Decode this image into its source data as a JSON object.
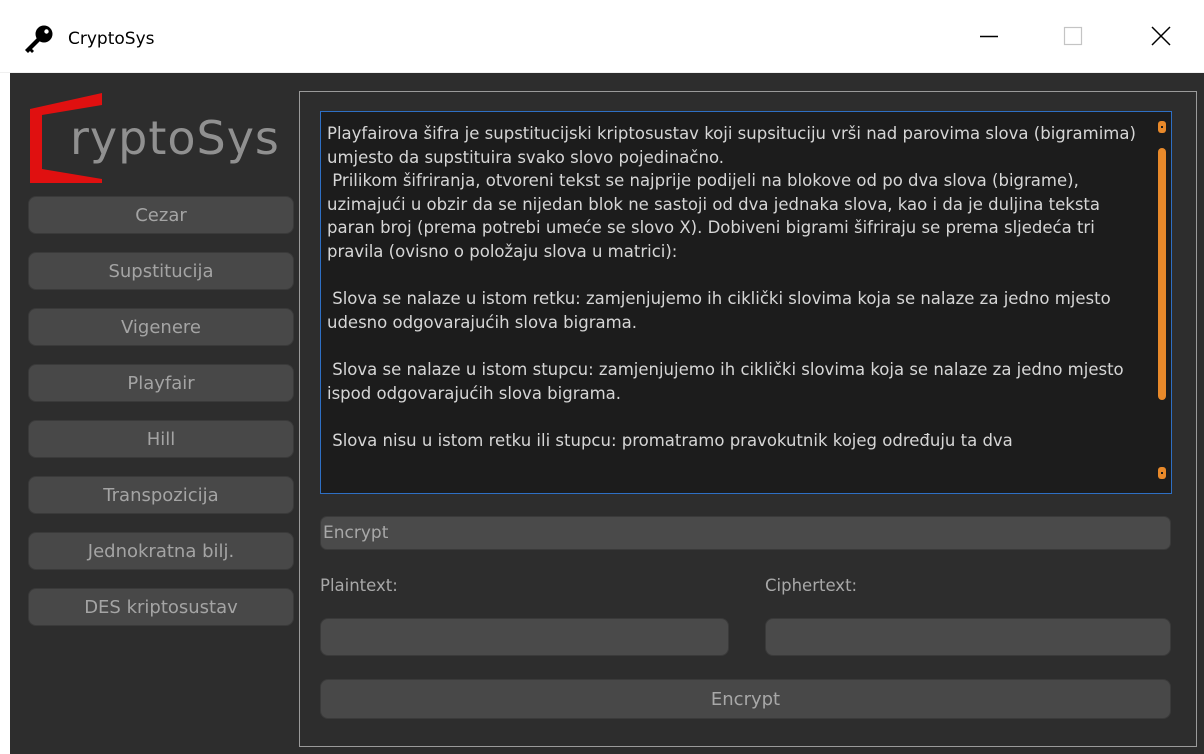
{
  "window": {
    "title": "CryptoSys",
    "icon": "key-icon"
  },
  "logo": {
    "text": "ryptoSys",
    "accent_color": "#e01010"
  },
  "sidebar": {
    "items": [
      {
        "label": "Cezar"
      },
      {
        "label": "Supstitucija"
      },
      {
        "label": "Vigenere"
      },
      {
        "label": "Playfair"
      },
      {
        "label": "Hill"
      },
      {
        "label": "Transpozicija"
      },
      {
        "label": "Jednokratna bilj."
      },
      {
        "label": "DES kriptosustav"
      }
    ]
  },
  "main": {
    "description": "Playfairova šifra je supstitucijski kriptosustav koji supsituciju vrši nad parovima slova (bigramima) umjesto da supstituira svako slovo pojedinačno.\n Prilikom šifriranja, otvoreni tekst se najprije podijeli na blokove od po dva slova (bigrame), uzimajući u obzir da se nijedan blok ne sastoji od dva jednaka slova, kao i da je duljina teksta paran broj (prema potrebi umeće se slovo X). Dobiveni bigrami šifriraju se prema sljedeća tri pravila (ovisno o položaju slova u matrici):\n\n Slova se nalaze u istom retku: zamjenjujemo ih ciklički slovima koja se nalaze za jedno mjesto udesno odgovarajućih slova bigrama.\n\n Slova se nalaze u istom stupcu: zamjenjujemo ih ciklički slovima koja se nalaze za jedno mjesto ispod odgovarajućih slova bigrama.\n\n Slova nisu u istom retku ili stupcu: promatramo pravokutnik kojeg određuju ta dva",
    "mode_select": "Encrypt",
    "plaintext_label": "Plaintext:",
    "ciphertext_label": "Ciphertext:",
    "plaintext_value": "",
    "ciphertext_value": "",
    "action_button": "Encrypt",
    "scrollbar_color": "#e8892a",
    "focus_border_color": "#2e6fc4"
  }
}
